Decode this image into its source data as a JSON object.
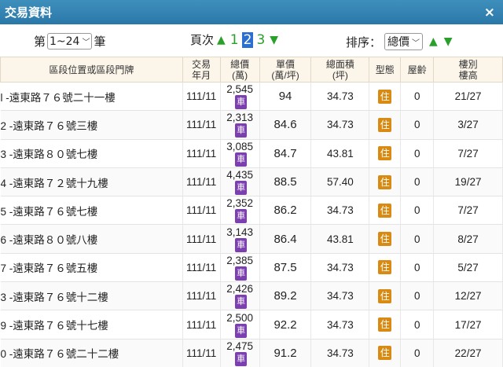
{
  "window": {
    "title": "交易資料",
    "close_icon": "×"
  },
  "controls": {
    "page_prefix": "第",
    "page_range": "1~24",
    "page_suffix": "筆",
    "pages_label": "頁次",
    "pages": [
      "1",
      "2",
      "3"
    ],
    "active_page": "2",
    "sort_label": "排序：",
    "sort_value": "總價"
  },
  "colors": {
    "title_bar": "#2a78a8",
    "arrow": "#2aa02a",
    "car_badge": "#7b3fb0",
    "type_badge": "#d88a12",
    "active_page": "#2b6fd1"
  },
  "table": {
    "headers": {
      "address": "區段位置或區段門牌",
      "date_1": "交易",
      "date_2": "年月",
      "total_1": "總價",
      "total_2": "(萬)",
      "unit_1": "單價",
      "unit_2": "(萬/坪)",
      "area_1": "總面積",
      "area_2": "(坪)",
      "type": "型態",
      "age": "屋齡",
      "floor_1": "樓別",
      "floor_2": "樓高"
    },
    "car_badge": "車",
    "rows": [
      {
        "addr": "l -遠東路７６號二十一樓",
        "date": "111/11",
        "total": "2,545",
        "unit": "94",
        "area": "34.73",
        "type": "住",
        "age": "0",
        "floor": "21/27"
      },
      {
        "addr": "2 -遠東路７６號三樓",
        "date": "111/11",
        "total": "2,313",
        "unit": "84.6",
        "area": "34.73",
        "type": "住",
        "age": "0",
        "floor": "3/27"
      },
      {
        "addr": "3 -遠東路８０號七樓",
        "date": "111/11",
        "total": "3,085",
        "unit": "84.7",
        "area": "43.81",
        "type": "住",
        "age": "0",
        "floor": "7/27"
      },
      {
        "addr": "4 -遠東路７２號十九樓",
        "date": "111/11",
        "total": "4,435",
        "unit": "88.5",
        "area": "57.40",
        "type": "住",
        "age": "0",
        "floor": "19/27"
      },
      {
        "addr": "5 -遠東路７６號七樓",
        "date": "111/11",
        "total": "2,352",
        "unit": "86.2",
        "area": "34.73",
        "type": "住",
        "age": "0",
        "floor": "7/27"
      },
      {
        "addr": "6 -遠東路８０號八樓",
        "date": "111/11",
        "total": "3,143",
        "unit": "86.4",
        "area": "43.81",
        "type": "住",
        "age": "0",
        "floor": "8/27"
      },
      {
        "addr": "7 -遠東路７６號五樓",
        "date": "111/11",
        "total": "2,385",
        "unit": "87.5",
        "area": "34.73",
        "type": "住",
        "age": "0",
        "floor": "5/27"
      },
      {
        "addr": "3 -遠東路７６號十二樓",
        "date": "111/11",
        "total": "2,426",
        "unit": "89.2",
        "area": "34.73",
        "type": "住",
        "age": "0",
        "floor": "12/27"
      },
      {
        "addr": "9 -遠東路７６號十七樓",
        "date": "111/11",
        "total": "2,500",
        "unit": "92.2",
        "area": "34.73",
        "type": "住",
        "age": "0",
        "floor": "17/27"
      },
      {
        "addr": "0 -遠東路７６號二十二樓",
        "date": "111/11",
        "total": "2,475",
        "unit": "91.2",
        "area": "34.73",
        "type": "住",
        "age": "0",
        "floor": "22/27"
      }
    ]
  }
}
